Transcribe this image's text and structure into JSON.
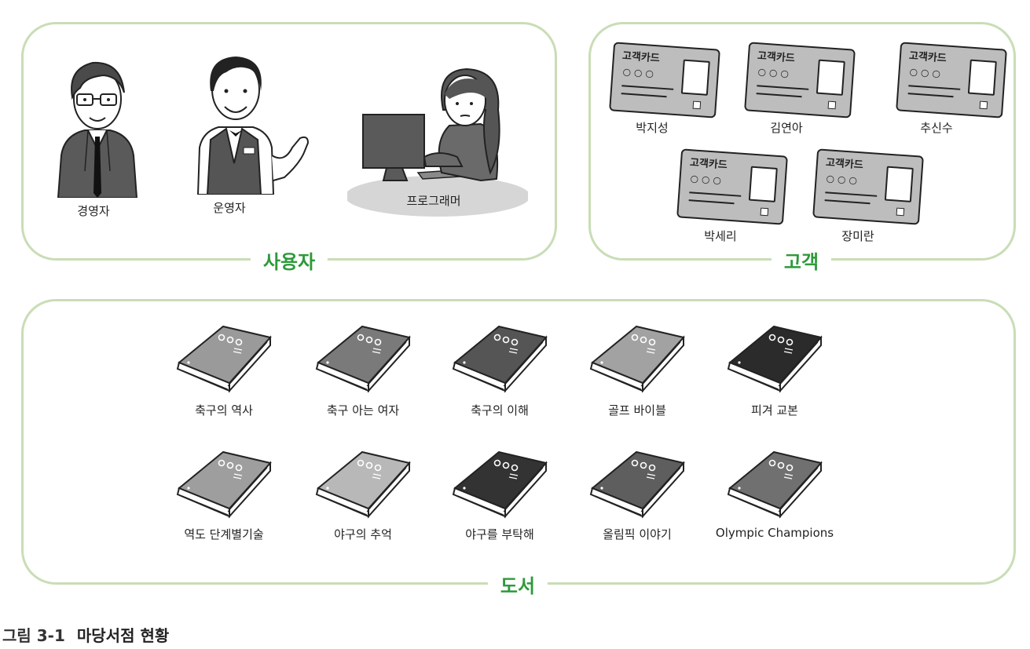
{
  "users": {
    "title": "사용자",
    "people": [
      {
        "label": "경영자"
      },
      {
        "label": "운영자"
      },
      {
        "label": "프로그래머"
      }
    ]
  },
  "customers": {
    "title": "고객",
    "card_text": "고객카드",
    "cards": [
      {
        "label": "박지성"
      },
      {
        "label": "김연아"
      },
      {
        "label": "추신수"
      },
      {
        "label": "박세리"
      },
      {
        "label": "장미란"
      }
    ]
  },
  "books": {
    "title": "도서",
    "items": [
      {
        "label": "축구의 역사",
        "color": "#9a9a9a"
      },
      {
        "label": "축구 아는 여자",
        "color": "#7a7a7a"
      },
      {
        "label": "축구의 이해",
        "color": "#555555"
      },
      {
        "label": "골프 바이블",
        "color": "#a2a2a2"
      },
      {
        "label": "피겨 교본",
        "color": "#2b2b2b"
      },
      {
        "label": "역도 단계별기술",
        "color": "#9e9e9e"
      },
      {
        "label": "야구의 추억",
        "color": "#b8b8b8"
      },
      {
        "label": "야구를 부탁해",
        "color": "#333333"
      },
      {
        "label": "올림픽 이야기",
        "color": "#5e5e5e"
      },
      {
        "label": "Olympic Champions",
        "color": "#707070"
      }
    ]
  },
  "caption": {
    "number": "그림 3-1",
    "text": "마당서점 현황"
  },
  "colors": {
    "panel_border": "#c9ddb6",
    "panel_title": "#2e9a3a"
  }
}
